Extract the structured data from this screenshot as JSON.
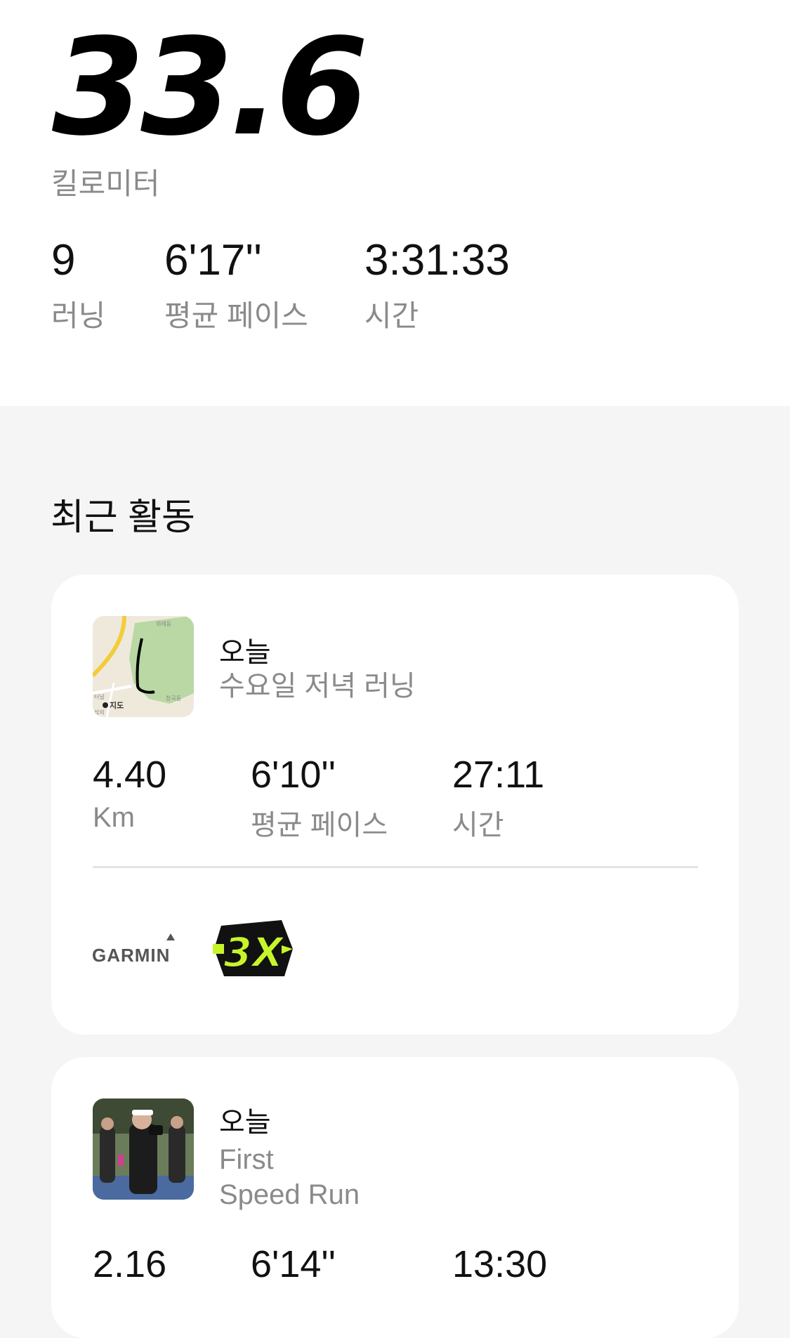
{
  "summary": {
    "distance_value": "33.6",
    "distance_unit": "킬로미터",
    "runs_value": "9",
    "runs_label": "러닝",
    "pace_value": "6'17''",
    "pace_label": "평균 페이스",
    "time_value": "3:31:33",
    "time_label": "시간"
  },
  "recent": {
    "section_title": "최근 활동",
    "activities": [
      {
        "date": "오늘",
        "title": "수요일 저녁 러닝",
        "distance_value": "4.40",
        "distance_unit": "Km",
        "pace_value": "6'10''",
        "pace_label": "평균 페이스",
        "time_value": "27:11",
        "time_label": "시간",
        "map_text": {
          "top": "위례동",
          "right": "창곡동",
          "left": "터널",
          "left2": "삼의",
          "maps_logo": "지도"
        },
        "device_logo": "GARMIN",
        "badge_text": "3X",
        "badge_color": "#c8f52a"
      },
      {
        "date": "오늘",
        "title_line1": "First",
        "title_line2": "Speed Run",
        "distance_value": "2.16",
        "pace_value": "6'14''",
        "time_value": "13:30"
      }
    ]
  }
}
